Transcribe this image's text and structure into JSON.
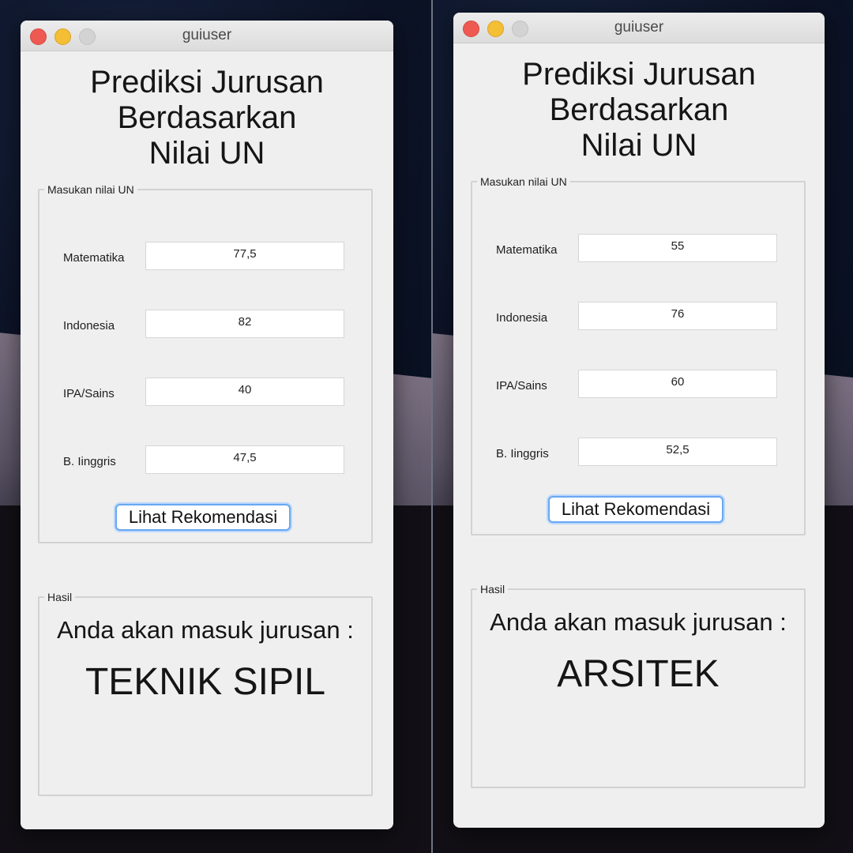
{
  "windows": [
    {
      "title": "guiuser",
      "heading": [
        "Prediksi Jurusan",
        "Berdasarkan",
        "Nilai UN"
      ],
      "input_group": {
        "legend": "Masukan nilai UN",
        "fields": [
          {
            "label": "Matematika",
            "value": "77,5"
          },
          {
            "label": "Indonesia",
            "value": "82"
          },
          {
            "label": "IPA/Sains",
            "value": "40"
          },
          {
            "label": "B. Iinggris",
            "value": "47,5"
          }
        ],
        "button": "Lihat Rekomendasi"
      },
      "result_group": {
        "legend": "Hasil",
        "label": "Anda akan masuk jurusan :",
        "value": "TEKNIK SIPIL"
      }
    },
    {
      "title": "guiuser",
      "heading": [
        "Prediksi Jurusan",
        "Berdasarkan",
        "Nilai UN"
      ],
      "input_group": {
        "legend": "Masukan nilai UN",
        "fields": [
          {
            "label": "Matematika",
            "value": "55"
          },
          {
            "label": "Indonesia",
            "value": "76"
          },
          {
            "label": "IPA/Sains",
            "value": "60"
          },
          {
            "label": "B. Iinggris",
            "value": "52,5"
          }
        ],
        "button": "Lihat Rekomendasi"
      },
      "result_group": {
        "legend": "Hasil",
        "label": "Anda akan masuk jurusan :",
        "value": "ARSITEK"
      }
    }
  ]
}
